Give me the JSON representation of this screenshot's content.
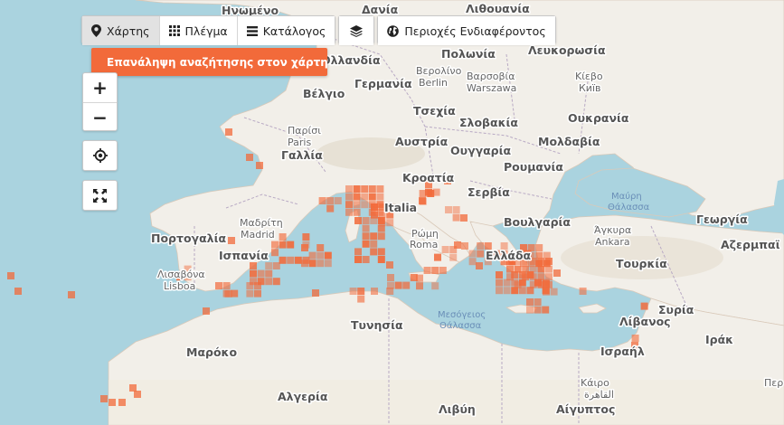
{
  "toolbar": {
    "map_label": "Χάρτης",
    "grid_label": "Πλέγμα",
    "catalog_label": "Κατάλογος",
    "areas_label": "Περιοχές Ενδιαφέροντος"
  },
  "search_again": {
    "label": "Επανάληψη αναζήτησης στον χάρτη"
  },
  "zoom": {
    "in_label": "+",
    "out_label": "−"
  },
  "colors": {
    "accent": "#f26a3a",
    "cell": "#f26a3a",
    "sea": "#aad3df",
    "land": "#f2efe9"
  },
  "map_labels": {
    "countries": [
      {
        "id": "lituania",
        "text": "Λιθουανία"
      },
      {
        "id": "danish",
        "text": "Δανία"
      },
      {
        "id": "netherlands",
        "text": "Ολλανδία"
      },
      {
        "id": "belgium",
        "text": "Βέλγιο"
      },
      {
        "id": "germany",
        "text": "Γερμανία"
      },
      {
        "id": "poland",
        "text": "Πολωνία"
      },
      {
        "id": "belarus",
        "text": "Λευκορωσία"
      },
      {
        "id": "ukraine",
        "text": "Ουκρανία"
      },
      {
        "id": "czech",
        "text": "Τσεχία"
      },
      {
        "id": "slovakia",
        "text": "Σλοβακία"
      },
      {
        "id": "france",
        "text": "Γαλλία"
      },
      {
        "id": "austria",
        "text": "Αυστρία"
      },
      {
        "id": "hungary",
        "text": "Ουγγαρία"
      },
      {
        "id": "moldova",
        "text": "Μολδαβία"
      },
      {
        "id": "romania",
        "text": "Ρουμανία"
      },
      {
        "id": "croatia",
        "text": "Κροατία"
      },
      {
        "id": "serbia",
        "text": "Σερβία"
      },
      {
        "id": "italy",
        "text": "Italia"
      },
      {
        "id": "bulgaria",
        "text": "Βουλγαρία"
      },
      {
        "id": "portugal",
        "text": "Πορτογαλία"
      },
      {
        "id": "spain",
        "text": "Ισπανία"
      },
      {
        "id": "greece",
        "text": "Ελλάδα"
      },
      {
        "id": "turkey",
        "text": "Τουρκία"
      },
      {
        "id": "georgia",
        "text": "Γεωργία"
      },
      {
        "id": "azerbaijan",
        "text": "Αζερμπαϊ"
      },
      {
        "id": "syria",
        "text": "Συρία"
      },
      {
        "id": "lebanon",
        "text": "Λίβανος"
      },
      {
        "id": "iraq",
        "text": "Ιράκ"
      },
      {
        "id": "israel",
        "text": "Ισραήλ"
      },
      {
        "id": "tunisia",
        "text": "Τυνησία"
      },
      {
        "id": "morocco",
        "text": "Μαρόκο"
      },
      {
        "id": "algeria",
        "text": "Αλγερία"
      },
      {
        "id": "libya",
        "text": "Λιβύη"
      },
      {
        "id": "egypt",
        "text": "Αίγυπτος"
      }
    ],
    "cities": [
      {
        "id": "berlin_gr",
        "text": "Βερολίνο"
      },
      {
        "id": "berlin",
        "text": "Berlin"
      },
      {
        "id": "warsaw_gr",
        "text": "Βαρσοβία"
      },
      {
        "id": "warsaw",
        "text": "Warszawa"
      },
      {
        "id": "kyiv_gr",
        "text": "Κίεβο"
      },
      {
        "id": "kyiv",
        "text": "Київ"
      },
      {
        "id": "paris_gr",
        "text": "Παρίσι"
      },
      {
        "id": "paris",
        "text": "Paris"
      },
      {
        "id": "rome_gr",
        "text": "Ρώμη"
      },
      {
        "id": "rome",
        "text": "Roma"
      },
      {
        "id": "madrid_gr",
        "text": "Μαδρίτη"
      },
      {
        "id": "madrid",
        "text": "Madrid"
      },
      {
        "id": "lisbon_gr",
        "text": "Λισαβόνα"
      },
      {
        "id": "lisbon",
        "text": "Lisboa"
      },
      {
        "id": "ankara_gr",
        "text": "Άγκυρα"
      },
      {
        "id": "ankara",
        "text": "Ankara"
      },
      {
        "id": "cairo_gr",
        "text": "Κάιρο"
      },
      {
        "id": "cairo",
        "text": "القاهرة"
      }
    ],
    "seas": [
      {
        "id": "black_sea_1",
        "text": "Μαύρη"
      },
      {
        "id": "black_sea_2",
        "text": "Θάλασσα"
      },
      {
        "id": "med_sea_1",
        "text": "Μεσόγειος"
      },
      {
        "id": "med_sea_2",
        "text": "Θάλασσα"
      }
    ],
    "edge": [
      {
        "id": "north_edge",
        "text": "Ηνωμένο"
      },
      {
        "id": "right_edge_top",
        "text": "Περ"
      }
    ]
  }
}
